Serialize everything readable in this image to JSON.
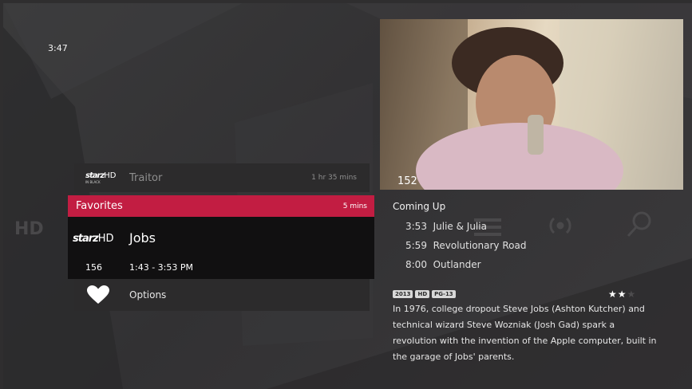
{
  "clock": "3:47",
  "preview": {
    "channel": "152"
  },
  "guide": {
    "previous": {
      "network": "starz",
      "network_suffix": "HD",
      "network_sub": "IN BLACK",
      "title": "Traitor",
      "duration": "1 hr 35 mins"
    },
    "category": {
      "label": "Favorites",
      "duration": "5 mins"
    },
    "current": {
      "network": "starz",
      "network_suffix": "HD",
      "title": "Jobs",
      "channel": "156",
      "time": "1:43 - 3:53 PM"
    },
    "options": {
      "label": "Options",
      "icon": "heart-icon"
    }
  },
  "coming_up": {
    "heading": "Coming Up",
    "items": [
      {
        "time": "3:53",
        "title": "Julie & Julia"
      },
      {
        "time": "5:59",
        "title": "Revolutionary Road"
      },
      {
        "time": "8:00",
        "title": "Outlander"
      }
    ]
  },
  "details": {
    "badges": [
      "2013",
      "HD",
      "PG-13"
    ],
    "stars_filled": 2,
    "stars_total": 3,
    "description": "In 1976, college dropout Steve Jobs (Ashton Kutcher) and technical wizard Steve Wozniak (Josh Gad) spark a revolution with the invention of the Apple computer, built in the garage of Jobs' parents."
  },
  "background_icons": [
    "hd-icon",
    "menu-icon",
    "wireless-icon",
    "search-icon"
  ],
  "colors": {
    "accent": "#c21d42",
    "background": "#343335"
  }
}
